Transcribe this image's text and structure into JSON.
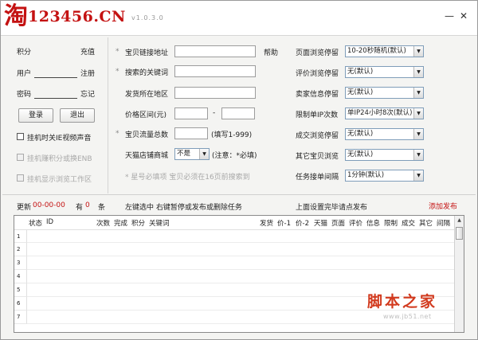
{
  "titlebar": {
    "logo_glyph": "淘",
    "logo_text": "123456.CN",
    "version": "v1.0.3.0",
    "minimize": "—",
    "close": "✕"
  },
  "left_panel": {
    "points_label": "积分",
    "recharge_link": "充值",
    "user_label": "用户",
    "register_link": "注册",
    "password_label": "密码",
    "forgot_link": "忘记",
    "login_button": "登录",
    "logout_button": "退出",
    "checkbox_mute": "挂机时关IE视频声音",
    "checkbox_switch": "挂机赚积分或换ENB",
    "checkbox_show": "挂机显示浏览工作区"
  },
  "middle_panel": {
    "url_label": "宝贝链接地址",
    "help_link": "帮助",
    "keyword_label": "搜索的关键词",
    "location_label": "发货所在地区",
    "price_label": "价格区间(元)",
    "price_dash": "-",
    "traffic_label": "宝贝流量总数",
    "traffic_hint": "(填写1-999)",
    "tmall_label": "天猫店铺商城",
    "tmall_value": "不是",
    "tmall_note": "(注意：*必填)",
    "footnote": "* 星号必填项 宝贝必须在16页前搜索到"
  },
  "right_panel": {
    "rows": [
      {
        "label": "页面浏览停留",
        "value": "10-20秒随机(默认)"
      },
      {
        "label": "评价浏览停留",
        "value": "无(默认)"
      },
      {
        "label": "卖家信息停留",
        "value": "无(默认)"
      },
      {
        "label": "限制单IP次数",
        "value": "单IP24小时8次(默认)"
      },
      {
        "label": "成交浏览停留",
        "value": "无(默认)"
      },
      {
        "label": "其它宝贝浏览",
        "value": "无(默认)"
      },
      {
        "label": "任务接单间隔",
        "value": "1分钟(默认)"
      }
    ]
  },
  "statusbar": {
    "update_label": "更新",
    "update_value": "00-00-00",
    "count_prefix": "有",
    "count_value": "0",
    "count_suffix": "条",
    "hint_left": "左键选中 右键暂停或发布或删除任务",
    "hint_right": "上面设置完毕请点发布",
    "publish_link": "添加发布"
  },
  "table": {
    "columns": [
      "状态",
      "ID",
      "次数",
      "完成",
      "积分",
      "关键词",
      "发货",
      "价-1",
      "价-2",
      "天猫",
      "页面",
      "评价",
      "信息",
      "限制",
      "成交",
      "其它",
      "间隔"
    ],
    "row_numbers": [
      "1",
      "2",
      "3",
      "4",
      "5",
      "6",
      "7"
    ],
    "scroll_up": "▲"
  },
  "watermark": {
    "text": "脚本之家",
    "url": "www.jb51.net"
  }
}
